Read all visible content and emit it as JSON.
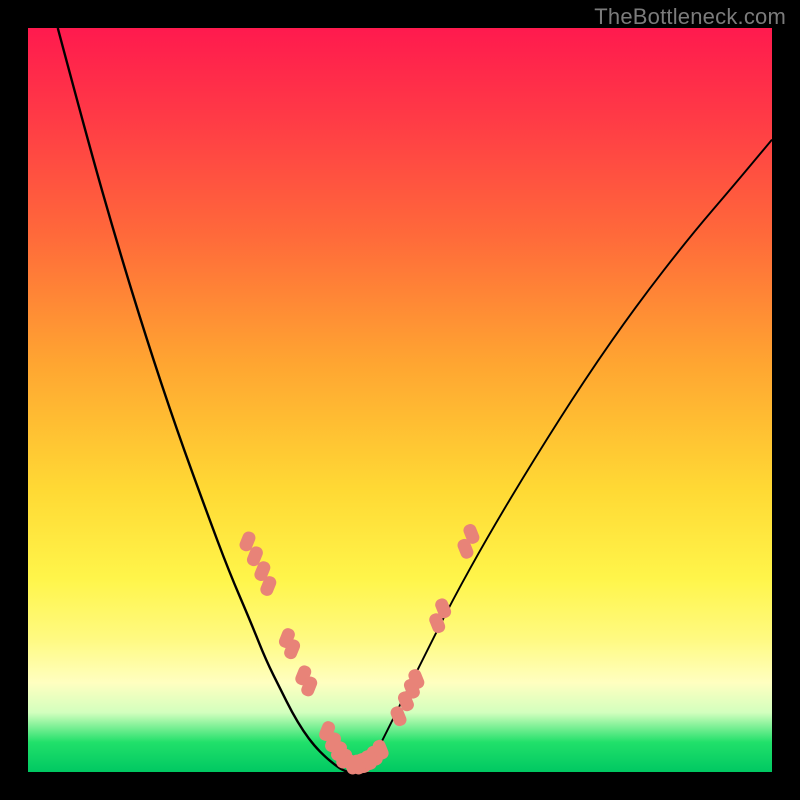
{
  "watermark": "TheBottleneck.com",
  "chart_data": {
    "type": "line",
    "title": "",
    "xlabel": "",
    "ylabel": "",
    "xlim": [
      0,
      100
    ],
    "ylim": [
      0,
      100
    ],
    "grid": false,
    "legend": false,
    "description": "Two smooth curves descending from the top edge into a narrow V-shaped minimum near the bottom center of a rainbow (red→green) gradient square. Small salmon-colored dots are clustered along both curve sides near the minimum.",
    "series": [
      {
        "name": "left-curve",
        "x": [
          4,
          8,
          12,
          16,
          20,
          24,
          27,
          30,
          32,
          34,
          35.5,
          37,
          38.5,
          40,
          41.2,
          42.2,
          43
        ],
        "y": [
          100,
          85,
          71,
          58,
          46,
          35,
          27,
          20,
          15,
          11,
          8,
          5.5,
          3.5,
          2,
          1,
          0.3,
          0
        ]
      },
      {
        "name": "right-curve",
        "x": [
          44,
          45,
          46.5,
          48,
          50,
          53,
          57,
          62,
          68,
          75,
          82,
          89,
          95,
          100
        ],
        "y": [
          0,
          0.5,
          2,
          5,
          9,
          15,
          23,
          32,
          42,
          53,
          63,
          72,
          79,
          85
        ]
      }
    ],
    "dots_left": [
      {
        "x": 29.5,
        "y": 31
      },
      {
        "x": 30.5,
        "y": 29
      },
      {
        "x": 31.5,
        "y": 27
      },
      {
        "x": 32.3,
        "y": 25
      },
      {
        "x": 34.8,
        "y": 18
      },
      {
        "x": 35.5,
        "y": 16.5
      },
      {
        "x": 37.0,
        "y": 13
      },
      {
        "x": 37.8,
        "y": 11.5
      },
      {
        "x": 40.2,
        "y": 5.5
      },
      {
        "x": 41.0,
        "y": 4
      },
      {
        "x": 41.8,
        "y": 2.8
      },
      {
        "x": 42.5,
        "y": 1.8
      }
    ],
    "dots_right": [
      {
        "x": 43.5,
        "y": 1
      },
      {
        "x": 44.3,
        "y": 1
      },
      {
        "x": 45.0,
        "y": 1.2
      },
      {
        "x": 45.8,
        "y": 1.6
      },
      {
        "x": 46.6,
        "y": 2.2
      },
      {
        "x": 47.4,
        "y": 3.0
      },
      {
        "x": 49.8,
        "y": 7.5
      },
      {
        "x": 50.8,
        "y": 9.5
      },
      {
        "x": 51.6,
        "y": 11.2
      },
      {
        "x": 52.2,
        "y": 12.5
      },
      {
        "x": 55.0,
        "y": 20
      },
      {
        "x": 55.8,
        "y": 22
      },
      {
        "x": 58.8,
        "y": 30
      },
      {
        "x": 59.6,
        "y": 32
      }
    ]
  }
}
